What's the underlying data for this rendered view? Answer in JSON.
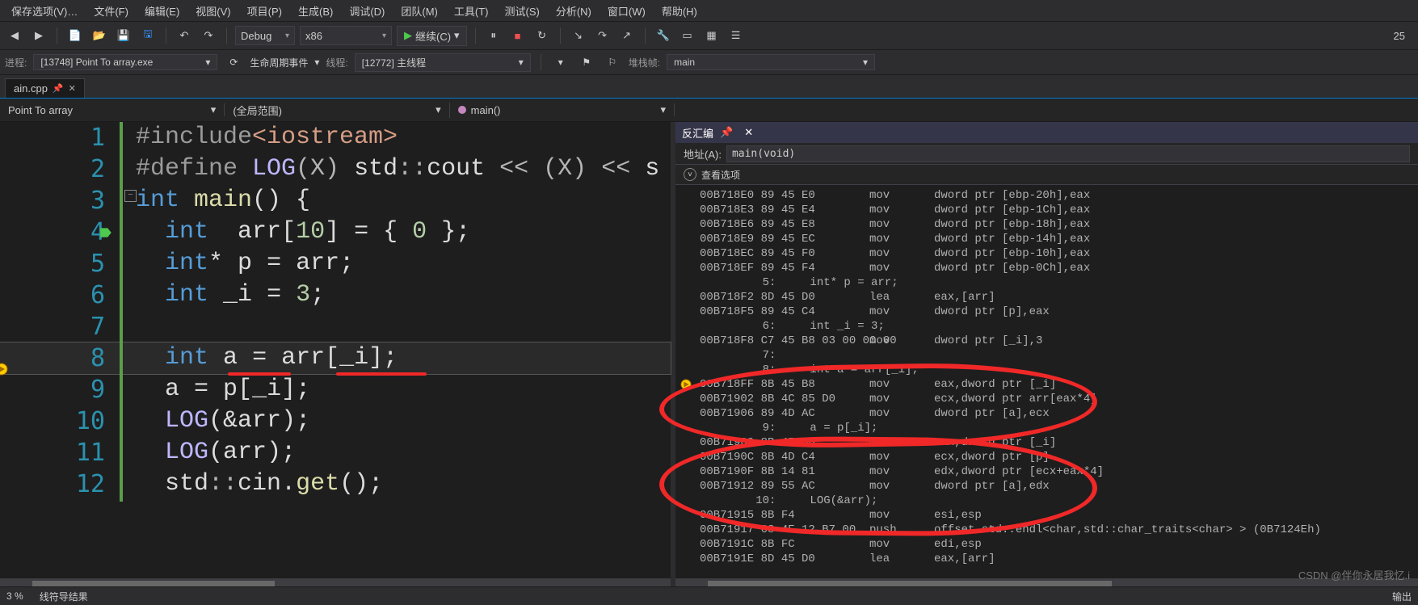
{
  "menubar": {
    "items": [
      "保存选项(V)…",
      "文件(F)",
      "编辑(E)",
      "视图(V)",
      "项目(P)",
      "生成(B)",
      "调试(D)",
      "团队(M)",
      "工具(T)",
      "测试(S)",
      "分析(N)",
      "窗口(W)",
      "帮助(H)"
    ]
  },
  "toolbar": {
    "config": "Debug",
    "platform": "x86",
    "run_label": "继续(C)"
  },
  "toolbar2": {
    "proc_label": "进程:",
    "proc_value": "[13748] Point To array.exe",
    "lifecycle": "生命周期事件",
    "thread_label": "线程:",
    "thread_value": "[12772] 主线程",
    "stack_label": "堆栈帧:",
    "stack_value": "main"
  },
  "tabs": {
    "active": "ain.cpp"
  },
  "nav": {
    "scope": "Point To array",
    "member": "(全局范围)",
    "func": "main()"
  },
  "code": {
    "lines": [
      {
        "n": 1,
        "html": "<span class='pp'>#include</span><span class='inc'>&lt;iostream&gt;</span>"
      },
      {
        "n": 2,
        "html": "<span class='pp'>#define </span><span class='mac'>LOG</span><span class='op'>(X) </span><span class='id'>std</span><span class='op'>::</span><span class='id'>cout</span> <span class='op'>&lt;&lt;</span> <span class='op'>(X)</span> <span class='op'>&lt;&lt;</span> <span class='id'>s</span>"
      },
      {
        "n": 3,
        "html": "<span class='kw'>int</span> <span class='fn'>main</span>() {"
      },
      {
        "n": 4,
        "html": "  <span class='kw'>int</span>  <span class='id'>arr</span>[<span class='num'>10</span>] = { <span class='num'>0</span> };"
      },
      {
        "n": 5,
        "html": "  <span class='kw'>int</span>* <span class='id'>p</span> = <span class='id'>arr</span>;"
      },
      {
        "n": 6,
        "html": "  <span class='kw'>int</span> <span class='id'>_i</span> = <span class='num'>3</span>;"
      },
      {
        "n": 7,
        "html": ""
      },
      {
        "n": 8,
        "html": "  <span class='kw'>int</span> <span class='id'>a</span> = <span class='id'>arr</span>[<span class='id'>_i</span>];"
      },
      {
        "n": 9,
        "html": "  <span class='id'>a</span> = <span class='id'>p</span>[<span class='id'>_i</span>];"
      },
      {
        "n": 10,
        "html": "  <span class='mac'>LOG</span>(&amp;<span class='id'>arr</span>);"
      },
      {
        "n": 11,
        "html": "  <span class='mac'>LOG</span>(<span class='id'>arr</span>);"
      },
      {
        "n": 12,
        "html": "  <span class='id'>std</span><span class='op'>::</span><span class='id'>cin</span>.<span class='fn'>get</span>();"
      }
    ],
    "bp_arrow_line": 4,
    "highlight_line": 8
  },
  "disasm": {
    "title": "反汇编",
    "addr_label": "地址(A):",
    "addr_value": "main(void)",
    "opts": "查看选项",
    "rows": [
      {
        "t": "i",
        "a": "00B718E0 89 45 E0",
        "m": "mov",
        "o": "dword ptr [ebp-20h],eax"
      },
      {
        "t": "i",
        "a": "00B718E3 89 45 E4",
        "m": "mov",
        "o": "dword ptr [ebp-1Ch],eax"
      },
      {
        "t": "i",
        "a": "00B718E6 89 45 E8",
        "m": "mov",
        "o": "dword ptr [ebp-18h],eax"
      },
      {
        "t": "i",
        "a": "00B718E9 89 45 EC",
        "m": "mov",
        "o": "dword ptr [ebp-14h],eax"
      },
      {
        "t": "i",
        "a": "00B718EC 89 45 F0",
        "m": "mov",
        "o": "dword ptr [ebp-10h],eax"
      },
      {
        "t": "i",
        "a": "00B718EF 89 45 F4",
        "m": "mov",
        "o": "dword ptr [ebp-0Ch],eax"
      },
      {
        "t": "s",
        "s": "    5:     int* p = arr;"
      },
      {
        "t": "i",
        "a": "00B718F2 8D 45 D0",
        "m": "lea",
        "o": "eax,[arr]"
      },
      {
        "t": "i",
        "a": "00B718F5 89 45 C4",
        "m": "mov",
        "o": "dword ptr [p],eax"
      },
      {
        "t": "s",
        "s": "    6:     int _i = 3;"
      },
      {
        "t": "i",
        "a": "00B718F8 C7 45 B8 03 00 00 00",
        "m": "mov",
        "o": "dword ptr [_i],3"
      },
      {
        "t": "s",
        "s": "    7:"
      },
      {
        "t": "s",
        "s": "    8:     int a = arr[_i];"
      },
      {
        "t": "i",
        "a": "00B718FF 8B 45 B8",
        "m": "mov",
        "o": "eax,dword ptr [_i]",
        "ptr": true
      },
      {
        "t": "i",
        "a": "00B71902 8B 4C 85 D0",
        "m": "mov",
        "o": "ecx,dword ptr arr[eax*4]"
      },
      {
        "t": "i",
        "a": "00B71906 89 4D AC",
        "m": "mov",
        "o": "dword ptr [a],ecx"
      },
      {
        "t": "s",
        "s": "    9:     a = p[_i];"
      },
      {
        "t": "i",
        "a": "00B71909 8B 45 B8",
        "m": "mov",
        "o": "eax,dword ptr [_i]"
      },
      {
        "t": "i",
        "a": "00B7190C 8B 4D C4",
        "m": "mov",
        "o": "ecx,dword ptr [p]"
      },
      {
        "t": "i",
        "a": "00B7190F 8B 14 81",
        "m": "mov",
        "o": "edx,dword ptr [ecx+eax*4]"
      },
      {
        "t": "i",
        "a": "00B71912 89 55 AC",
        "m": "mov",
        "o": "dword ptr [a],edx"
      },
      {
        "t": "s",
        "s": "   10:     LOG(&arr);"
      },
      {
        "t": "i",
        "a": "00B71915 8B F4",
        "m": "mov",
        "o": "esi,esp"
      },
      {
        "t": "i",
        "a": "00B71917 68 4E 12 B7 00",
        "m": "push",
        "o": "offset std::endl<char,std::char_traits<char> > (0B7124Eh)"
      },
      {
        "t": "i",
        "a": "00B7191C 8B FC",
        "m": "mov",
        "o": "edi,esp"
      },
      {
        "t": "i",
        "a": "00B7191E 8D 45 D0",
        "m": "lea",
        "o": "eax,[arr]"
      }
    ]
  },
  "status": {
    "left": "3 %",
    "mid": "线符导结果",
    "right_tab": "输出"
  },
  "watermark": "CSDN @伴你永居我忆.i",
  "top_right": "25"
}
